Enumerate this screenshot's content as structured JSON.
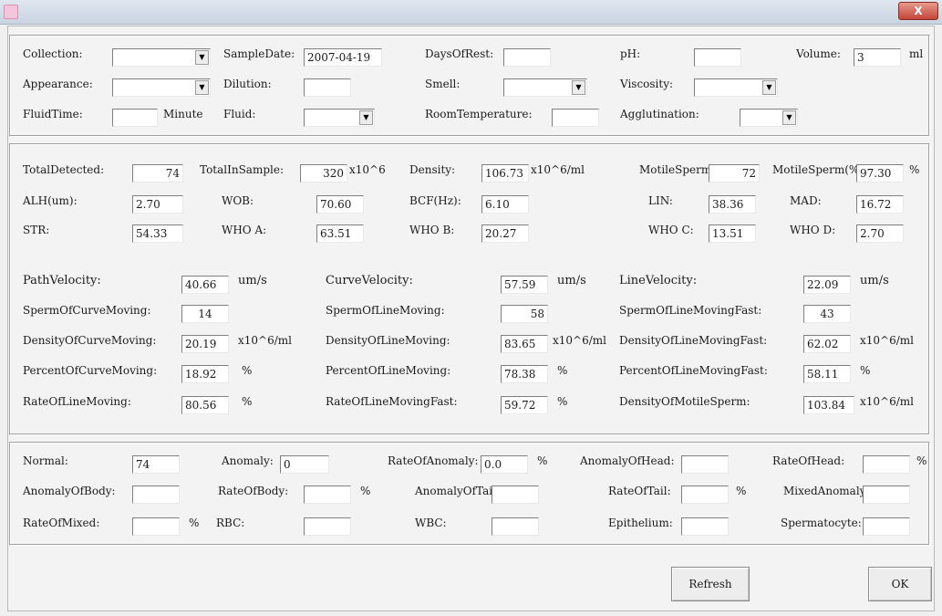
{
  "window": {
    "close_label": "X"
  },
  "collection": {
    "collection_label": "Collection:",
    "sample_date_label": "SampleDate:",
    "sample_date_value": "2007-04-19",
    "days_of_rest_label": "DaysOfRest:",
    "ph_label": "pH:",
    "volume_label": "Volume:",
    "volume_value": "3",
    "volume_unit": "ml",
    "appearance_label": "Appearance:",
    "dilution_label": "Dilution:",
    "smell_label": "Smell:",
    "viscosity_label": "Viscosity:",
    "fluid_time_label": "FluidTime:",
    "fluid_time_unit": "Minute",
    "fluid_label": "Fluid:",
    "room_temp_label": "RoomTemperature:",
    "agglutination_label": "Agglutination:"
  },
  "analysis": {
    "total_detected_label": "TotalDetected:",
    "total_detected_value": "74",
    "total_in_sample_label": "TotalInSample:",
    "total_in_sample_value": "320",
    "total_in_sample_unit": "x10^6",
    "density_label": "Density:",
    "density_value": "106.73",
    "density_unit": "x10^6/ml",
    "motile_label": "MotileSperm:",
    "motile_value": "72",
    "motile_pct_label": "MotileSperm(%)",
    "motile_pct_value": "97.30",
    "motile_pct_unit": "%",
    "alh_label": "ALH(um):",
    "alh_value": "2.70",
    "wob_label": "WOB:",
    "wob_value": "70.60",
    "bcf_label": "BCF(Hz):",
    "bcf_value": "6.10",
    "lin_label": "LIN:",
    "lin_value": "38.36",
    "mad_label": "MAD:",
    "mad_value": "16.72",
    "str_label": "STR:",
    "str_value": "54.33",
    "who_a_label": "WHO A:",
    "who_a_value": "63.51",
    "who_b_label": "WHO B:",
    "who_b_value": "20.27",
    "who_c_label": "WHO C:",
    "who_c_value": "13.51",
    "who_d_label": "WHO D:",
    "who_d_value": "2.70",
    "path_vel_label": "PathVelocity:",
    "path_vel_value": "40.66",
    "path_vel_unit": "um/s",
    "curve_vel_label": "CurveVelocity:",
    "curve_vel_value": "57.59",
    "curve_vel_unit": "um/s",
    "line_vel_label": "LineVelocity:",
    "line_vel_value": "22.09",
    "line_vel_unit": "um/s",
    "sperm_curve_label": "SpermOfCurveMoving:",
    "sperm_curve_value": "14",
    "sperm_line_label": "SpermOfLineMoving:",
    "sperm_line_value": "58",
    "sperm_line_fast_label": "SpermOfLineMovingFast:",
    "sperm_line_fast_value": "43",
    "dens_curve_label": "DensityOfCurveMoving:",
    "dens_curve_value": "20.19",
    "dens_curve_unit": "x10^6/ml",
    "dens_line_label": "DensityOfLineMoving:",
    "dens_line_value": "83.65",
    "dens_line_unit": "x10^6/ml",
    "dens_line_fast_label": "DensityOfLineMovingFast:",
    "dens_line_fast_value": "62.02",
    "dens_line_fast_unit": "x10^6/ml",
    "pct_curve_label": "PercentOfCurveMoving:",
    "pct_curve_value": "18.92",
    "pct_curve_unit": "%",
    "pct_line_label": "PercentOfLineMoving:",
    "pct_line_value": "78.38",
    "pct_line_unit": "%",
    "pct_line_fast_label": "PercentOfLineMovingFast:",
    "pct_line_fast_value": "58.11",
    "pct_line_fast_unit": "%",
    "rate_line_label": "RateOfLineMoving:",
    "rate_line_value": "80.56",
    "rate_line_unit": "%",
    "rate_line_fast_label": "RateOfLineMovingFast:",
    "rate_line_fast_value": "59.72",
    "rate_line_fast_unit": "%",
    "dens_motile_label": "DensityOfMotileSperm:",
    "dens_motile_value": "103.84",
    "dens_motile_unit": "x10^6/ml"
  },
  "morphology": {
    "normal_label": "Normal:",
    "normal_value": "74",
    "anomaly_label": "Anomaly:",
    "anomaly_value": "0",
    "rate_anomaly_label": "RateOfAnomaly:",
    "rate_anomaly_value": "0.0",
    "rate_anomaly_unit": "%",
    "anomaly_head_label": "AnomalyOfHead:",
    "rate_head_label": "RateOfHead:",
    "rate_head_unit": "%",
    "anomaly_body_label": "AnomalyOfBody:",
    "rate_body_label": "RateOfBody:",
    "rate_body_unit": "%",
    "anomaly_tail_label": "AnomalyOfTail:",
    "rate_tail_label": "RateOfTail:",
    "rate_tail_unit": "%",
    "mixed_anomaly_label": "MixedAnomaly:",
    "rate_mixed_label": "RateOfMixed:",
    "rate_mixed_unit": "%",
    "rbc_label": "RBC:",
    "wbc_label": "WBC:",
    "epithelium_label": "Epithelium:",
    "spermatocyte_label": "Spermatocyte:"
  },
  "buttons": {
    "refresh": "Refresh",
    "ok": "OK"
  }
}
